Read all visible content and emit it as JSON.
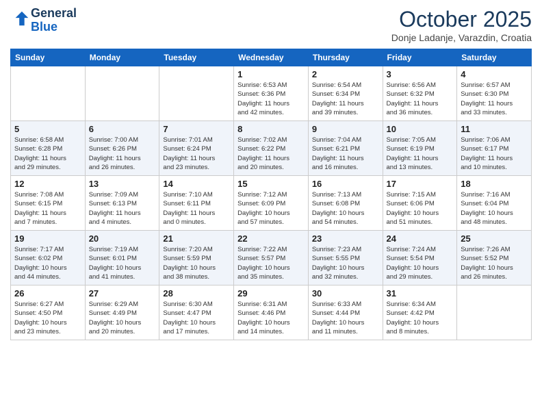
{
  "header": {
    "logo_line1": "General",
    "logo_line2": "Blue",
    "title": "October 2025",
    "location": "Donje Ladanje, Varazdin, Croatia"
  },
  "weekdays": [
    "Sunday",
    "Monday",
    "Tuesday",
    "Wednesday",
    "Thursday",
    "Friday",
    "Saturday"
  ],
  "weeks": [
    [
      {
        "day": "",
        "info": ""
      },
      {
        "day": "",
        "info": ""
      },
      {
        "day": "",
        "info": ""
      },
      {
        "day": "1",
        "info": "Sunrise: 6:53 AM\nSunset: 6:36 PM\nDaylight: 11 hours\nand 42 minutes."
      },
      {
        "day": "2",
        "info": "Sunrise: 6:54 AM\nSunset: 6:34 PM\nDaylight: 11 hours\nand 39 minutes."
      },
      {
        "day": "3",
        "info": "Sunrise: 6:56 AM\nSunset: 6:32 PM\nDaylight: 11 hours\nand 36 minutes."
      },
      {
        "day": "4",
        "info": "Sunrise: 6:57 AM\nSunset: 6:30 PM\nDaylight: 11 hours\nand 33 minutes."
      }
    ],
    [
      {
        "day": "5",
        "info": "Sunrise: 6:58 AM\nSunset: 6:28 PM\nDaylight: 11 hours\nand 29 minutes."
      },
      {
        "day": "6",
        "info": "Sunrise: 7:00 AM\nSunset: 6:26 PM\nDaylight: 11 hours\nand 26 minutes."
      },
      {
        "day": "7",
        "info": "Sunrise: 7:01 AM\nSunset: 6:24 PM\nDaylight: 11 hours\nand 23 minutes."
      },
      {
        "day": "8",
        "info": "Sunrise: 7:02 AM\nSunset: 6:22 PM\nDaylight: 11 hours\nand 20 minutes."
      },
      {
        "day": "9",
        "info": "Sunrise: 7:04 AM\nSunset: 6:21 PM\nDaylight: 11 hours\nand 16 minutes."
      },
      {
        "day": "10",
        "info": "Sunrise: 7:05 AM\nSunset: 6:19 PM\nDaylight: 11 hours\nand 13 minutes."
      },
      {
        "day": "11",
        "info": "Sunrise: 7:06 AM\nSunset: 6:17 PM\nDaylight: 11 hours\nand 10 minutes."
      }
    ],
    [
      {
        "day": "12",
        "info": "Sunrise: 7:08 AM\nSunset: 6:15 PM\nDaylight: 11 hours\nand 7 minutes."
      },
      {
        "day": "13",
        "info": "Sunrise: 7:09 AM\nSunset: 6:13 PM\nDaylight: 11 hours\nand 4 minutes."
      },
      {
        "day": "14",
        "info": "Sunrise: 7:10 AM\nSunset: 6:11 PM\nDaylight: 11 hours\nand 0 minutes."
      },
      {
        "day": "15",
        "info": "Sunrise: 7:12 AM\nSunset: 6:09 PM\nDaylight: 10 hours\nand 57 minutes."
      },
      {
        "day": "16",
        "info": "Sunrise: 7:13 AM\nSunset: 6:08 PM\nDaylight: 10 hours\nand 54 minutes."
      },
      {
        "day": "17",
        "info": "Sunrise: 7:15 AM\nSunset: 6:06 PM\nDaylight: 10 hours\nand 51 minutes."
      },
      {
        "day": "18",
        "info": "Sunrise: 7:16 AM\nSunset: 6:04 PM\nDaylight: 10 hours\nand 48 minutes."
      }
    ],
    [
      {
        "day": "19",
        "info": "Sunrise: 7:17 AM\nSunset: 6:02 PM\nDaylight: 10 hours\nand 44 minutes."
      },
      {
        "day": "20",
        "info": "Sunrise: 7:19 AM\nSunset: 6:01 PM\nDaylight: 10 hours\nand 41 minutes."
      },
      {
        "day": "21",
        "info": "Sunrise: 7:20 AM\nSunset: 5:59 PM\nDaylight: 10 hours\nand 38 minutes."
      },
      {
        "day": "22",
        "info": "Sunrise: 7:22 AM\nSunset: 5:57 PM\nDaylight: 10 hours\nand 35 minutes."
      },
      {
        "day": "23",
        "info": "Sunrise: 7:23 AM\nSunset: 5:55 PM\nDaylight: 10 hours\nand 32 minutes."
      },
      {
        "day": "24",
        "info": "Sunrise: 7:24 AM\nSunset: 5:54 PM\nDaylight: 10 hours\nand 29 minutes."
      },
      {
        "day": "25",
        "info": "Sunrise: 7:26 AM\nSunset: 5:52 PM\nDaylight: 10 hours\nand 26 minutes."
      }
    ],
    [
      {
        "day": "26",
        "info": "Sunrise: 6:27 AM\nSunset: 4:50 PM\nDaylight: 10 hours\nand 23 minutes."
      },
      {
        "day": "27",
        "info": "Sunrise: 6:29 AM\nSunset: 4:49 PM\nDaylight: 10 hours\nand 20 minutes."
      },
      {
        "day": "28",
        "info": "Sunrise: 6:30 AM\nSunset: 4:47 PM\nDaylight: 10 hours\nand 17 minutes."
      },
      {
        "day": "29",
        "info": "Sunrise: 6:31 AM\nSunset: 4:46 PM\nDaylight: 10 hours\nand 14 minutes."
      },
      {
        "day": "30",
        "info": "Sunrise: 6:33 AM\nSunset: 4:44 PM\nDaylight: 10 hours\nand 11 minutes."
      },
      {
        "day": "31",
        "info": "Sunrise: 6:34 AM\nSunset: 4:42 PM\nDaylight: 10 hours\nand 8 minutes."
      },
      {
        "day": "",
        "info": ""
      }
    ]
  ]
}
